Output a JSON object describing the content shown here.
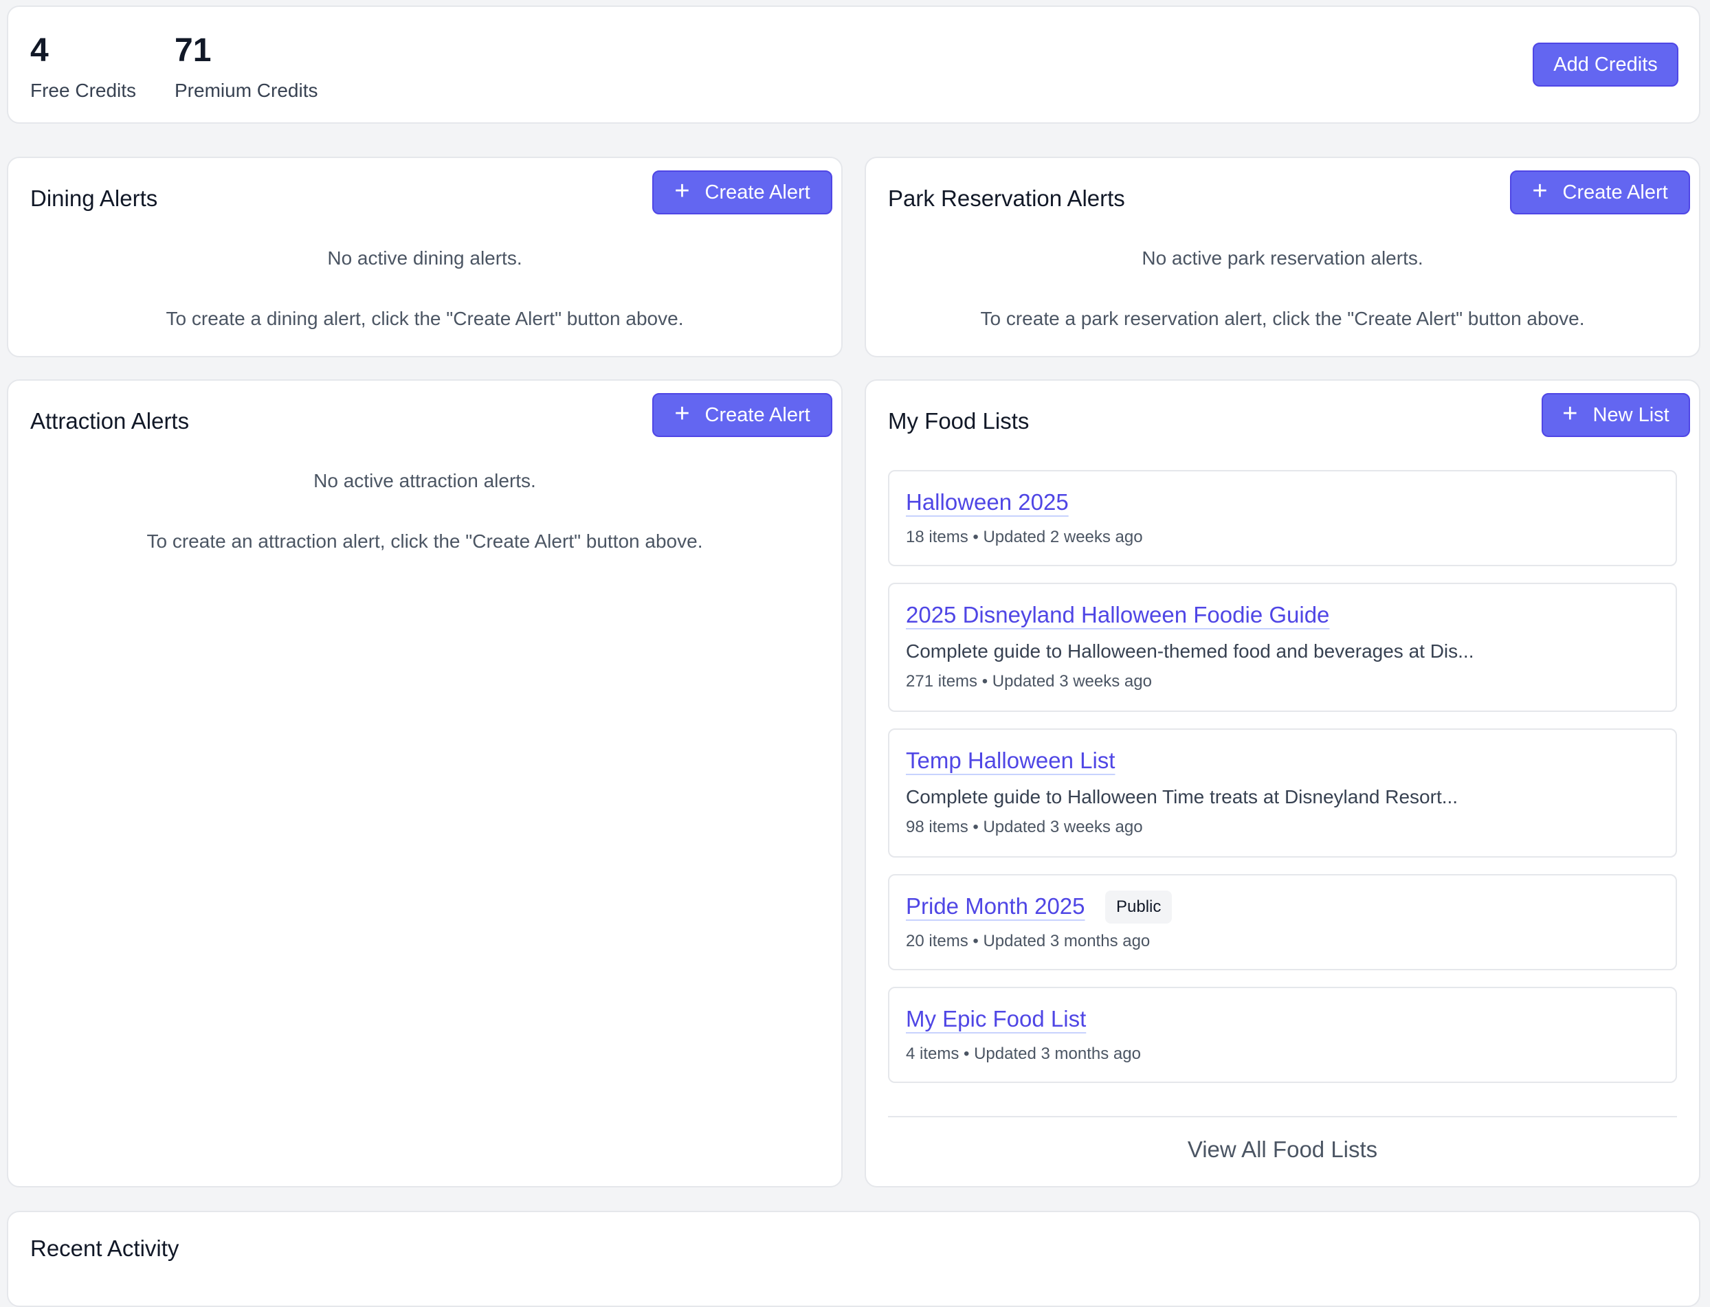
{
  "credits": {
    "free_value": "4",
    "free_label": "Free Credits",
    "premium_value": "71",
    "premium_label": "Premium Credits",
    "add_button": "Add Credits"
  },
  "dining": {
    "title": "Dining Alerts",
    "button": "Create Alert",
    "empty": "No active dining alerts.",
    "hint": "To create a dining alert, click the \"Create Alert\" button above."
  },
  "park": {
    "title": "Park Reservation Alerts",
    "button": "Create Alert",
    "empty": "No active park reservation alerts.",
    "hint": "To create a park reservation alert, click the \"Create Alert\" button above."
  },
  "attraction": {
    "title": "Attraction Alerts",
    "button": "Create Alert",
    "empty": "No active attraction alerts.",
    "hint": "To create an attraction alert, click the \"Create Alert\" button above."
  },
  "food_lists": {
    "title": "My Food Lists",
    "button": "New List",
    "items": [
      {
        "title": "Halloween 2025",
        "meta": "18 items • Updated 2 weeks ago"
      },
      {
        "title": "2025 Disneyland Halloween Foodie Guide",
        "desc": "Complete guide to Halloween-themed food and beverages at Dis...",
        "meta": "271 items • Updated 3 weeks ago"
      },
      {
        "title": "Temp Halloween List",
        "desc": "Complete guide to Halloween Time treats at Disneyland Resort...",
        "meta": "98 items • Updated 3 weeks ago"
      },
      {
        "title": "Pride Month 2025",
        "badge": "Public",
        "meta": "20 items • Updated 3 months ago"
      },
      {
        "title": "My Epic Food List",
        "meta": "4 items • Updated 3 months ago"
      }
    ],
    "view_all": "View All Food Lists"
  },
  "recent_activity": {
    "title": "Recent Activity"
  },
  "colors": {
    "accent": "#6366f1",
    "link": "#4f46e5",
    "background": "#f3f4f6"
  }
}
